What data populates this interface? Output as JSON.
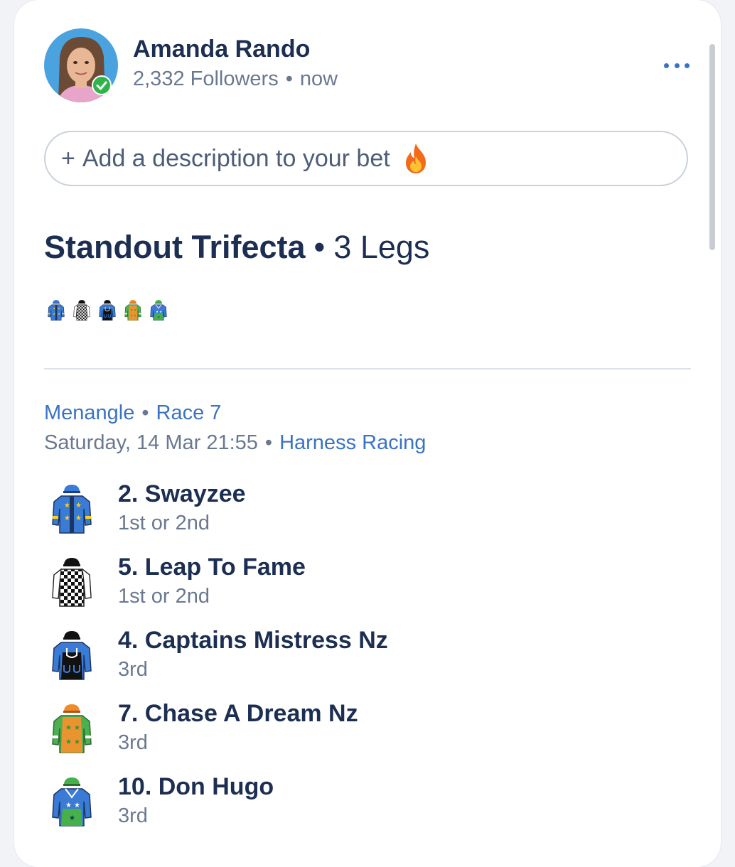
{
  "user": {
    "name": "Amanda Rando",
    "followers": "2,332 Followers",
    "time": "now",
    "verified": true
  },
  "description": {
    "plus": "+",
    "placeholder": "Add a description to your bet",
    "emoji": "flame-icon"
  },
  "bet": {
    "type": "Standout Trifecta",
    "legs": "3 Legs"
  },
  "race": {
    "venue": "Menangle",
    "race": "Race 7",
    "datetime": "Saturday, 14 Mar 21:55",
    "category": "Harness Racing"
  },
  "runners": [
    {
      "name": "2. Swayzee",
      "position": "1st or 2nd",
      "silk": "blue-yellow-stars"
    },
    {
      "name": "5. Leap To Fame",
      "position": "1st or 2nd",
      "silk": "black-white-checks"
    },
    {
      "name": "4. Captains Mistress Nz",
      "position": "3rd",
      "silk": "black-blue-horseshoes"
    },
    {
      "name": "7. Chase A Dream Nz",
      "position": "3rd",
      "silk": "orange-green-stars"
    },
    {
      "name": "10. Don Hugo",
      "position": "3rd",
      "silk": "green-blue-stars"
    }
  ],
  "colors": {
    "title": "#1c2f52",
    "muted": "#6a7890",
    "accent": "#3a73c4",
    "border": "#c9d1dd"
  }
}
